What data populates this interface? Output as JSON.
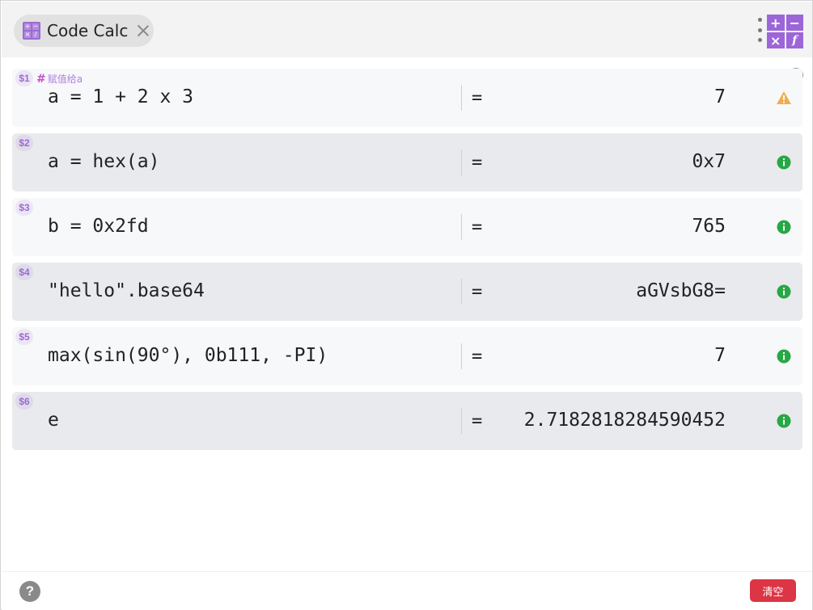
{
  "tab": {
    "title": "Code Calc"
  },
  "tab_icon_glyphs": [
    "+",
    "−",
    "×",
    "/"
  ],
  "app_icon_glyphs": [
    "+",
    "−",
    "×",
    "f"
  ],
  "colors": {
    "accent": "#9b6bd1",
    "warning": "#f0ad4e",
    "info": "#28a745",
    "danger": "#dc3545"
  },
  "rows": [
    {
      "num": "$1",
      "comment_mark": "#",
      "comment": "赋值给a",
      "expr": "a = 1 + 2 x 3",
      "eq": "=",
      "result": "7",
      "status": "warning-icon"
    },
    {
      "num": "$2",
      "comment_mark": "",
      "comment": "",
      "expr": "a = hex(a)",
      "eq": "=",
      "result": "0x7",
      "status": "info-icon"
    },
    {
      "num": "$3",
      "comment_mark": "",
      "comment": "",
      "expr": "b = 0x2fd",
      "eq": "=",
      "result": "765",
      "status": "info-icon"
    },
    {
      "num": "$4",
      "comment_mark": "",
      "comment": "",
      "expr": "\"hello\".base64",
      "eq": "=",
      "result": "aGVsbG8=",
      "status": "info-icon"
    },
    {
      "num": "$5",
      "comment_mark": "",
      "comment": "",
      "expr": "max(sin(90°), 0b111, -PI)",
      "eq": "=",
      "result": "7",
      "status": "info-icon"
    },
    {
      "num": "$6",
      "comment_mark": "",
      "comment": "",
      "expr": "e",
      "eq": "=",
      "result": "2.7182818284590452",
      "status": "info-icon"
    }
  ],
  "footer": {
    "help_label": "?",
    "clear_label": "清空"
  }
}
